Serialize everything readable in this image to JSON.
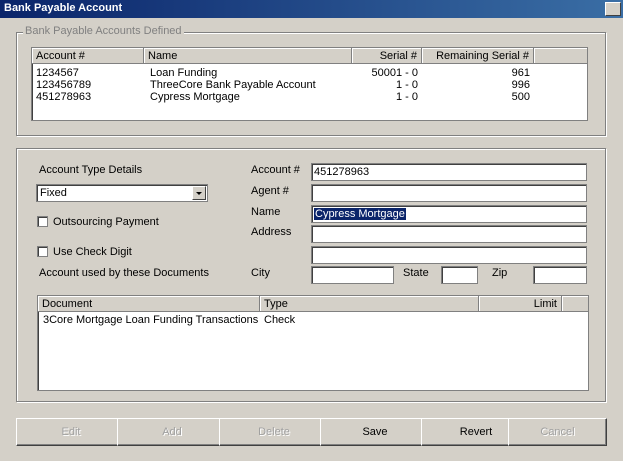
{
  "window": {
    "title": "Bank Payable Account"
  },
  "accounts_group": {
    "legend": "Bank Payable Accounts Defined",
    "columns": [
      "Account #",
      "Name",
      "Serial #",
      "Remaining Serial #"
    ],
    "rows": [
      [
        "1234567",
        "Loan Funding",
        "50001 - 0",
        "961"
      ],
      [
        "123456789",
        "ThreeCore Bank Payable Account",
        "1 - 0",
        "996"
      ],
      [
        "451278963",
        "Cypress Mortgage",
        "1 - 0",
        "500"
      ]
    ]
  },
  "details": {
    "account_type_label": "Account Type Details",
    "account_type_value": "Fixed",
    "outsourcing_label": "Outsourcing Payment",
    "outsourcing_checked": false,
    "check_digit_label": "Use Check Digit",
    "check_digit_checked": false,
    "documents_label": "Account used by these Documents",
    "account_num_label": "Account #",
    "account_num_value": "451278963",
    "agent_label": "Agent #",
    "agent_value": "",
    "name_label": "Name",
    "name_value": "Cypress Mortgage",
    "address_label": "Address",
    "address_line1": "",
    "address_line2": "",
    "city_label": "City",
    "city_value": "",
    "state_label": "State",
    "state_value": "",
    "zip_label": "Zip",
    "zip_value": ""
  },
  "documents": {
    "columns": [
      "Document",
      "Type",
      "Limit"
    ],
    "rows": [
      [
        "3Core Mortgage Loan Funding Transactions",
        "Check",
        ""
      ]
    ]
  },
  "buttons": {
    "edit": "Edit",
    "add": "Add",
    "delete": "Delete",
    "save": "Save",
    "revert": "Revert",
    "cancel": "Cancel"
  }
}
